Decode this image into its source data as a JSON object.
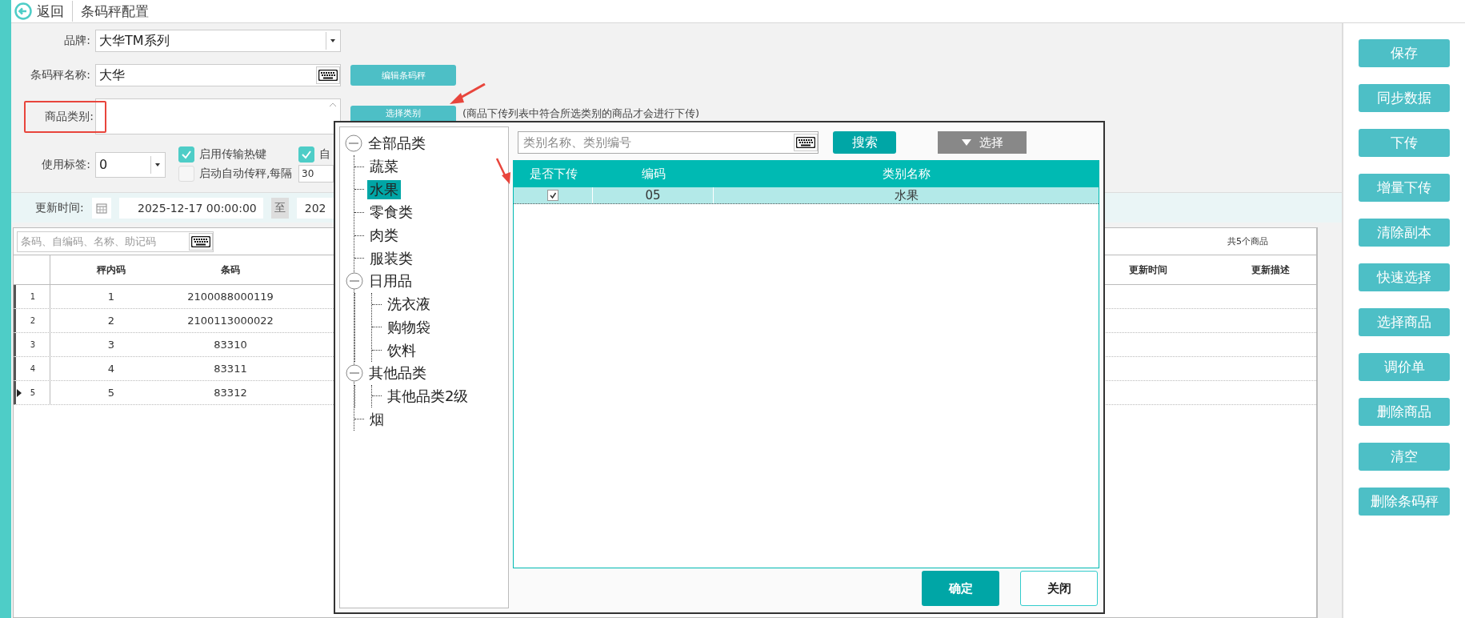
{
  "header": {
    "back": "返回",
    "title": "条码秤配置"
  },
  "form": {
    "brand": {
      "label": "品牌:",
      "value": "大华TM系列"
    },
    "scale_name": {
      "label": "条码秤名称:",
      "value": "大华"
    },
    "edit_button": "编辑条码秤",
    "category": {
      "label": "商品类别:",
      "highlighted": true
    },
    "select_category_button": "选择类别",
    "hint": "(商品下传列表中符合所选类别的商品才会进行下传)",
    "tag": {
      "label": "使用标签:",
      "value": "0"
    },
    "options": [
      {
        "label": "启用传输热键",
        "checked": true
      },
      {
        "label": "启动自动传秤,每隔",
        "checked": false
      },
      {
        "label": "自",
        "checked": true
      }
    ],
    "interval": "30"
  },
  "filter": {
    "label": "更新时间:",
    "from": "2025-12-17 00:00:00",
    "separator": "至",
    "to": "202"
  },
  "grid": {
    "search_placeholder": "条码、自编码、名称、助记码",
    "count": "共5个商品",
    "columns": [
      "秤内码",
      "条码",
      "更新时间",
      "更新描述"
    ],
    "rows": [
      {
        "number": "1",
        "code": "1",
        "barcode": "2100088000119",
        "current": false
      },
      {
        "number": "2",
        "code": "2",
        "barcode": "2100113000022",
        "current": false
      },
      {
        "number": "3",
        "code": "3",
        "barcode": "83310",
        "current": false
      },
      {
        "number": "4",
        "code": "4",
        "barcode": "83311",
        "current": false
      },
      {
        "number": "5",
        "code": "5",
        "barcode": "83312",
        "current": true
      }
    ]
  },
  "actions": [
    "保存",
    "同步数据",
    "下传",
    "增量下传",
    "清除副本",
    "快速选择",
    "选择商品",
    "调价单",
    "删除商品",
    "清空",
    "删除条码秤"
  ],
  "dialog": {
    "tree": [
      {
        "label": "全部品类",
        "selected": false,
        "expanded": true,
        "children": [
          {
            "label": "蔬菜",
            "selected": false
          },
          {
            "label": "水果",
            "selected": true
          },
          {
            "label": "零食类",
            "selected": false
          },
          {
            "label": "肉类",
            "selected": false
          },
          {
            "label": "服装类",
            "selected": false
          },
          {
            "label": "日用品",
            "selected": false,
            "expanded": true,
            "children": [
              {
                "label": "洗衣液",
                "selected": false
              },
              {
                "label": "购物袋",
                "selected": false
              },
              {
                "label": "饮料",
                "selected": false
              }
            ]
          },
          {
            "label": "其他品类",
            "selected": false,
            "expanded": true,
            "children": [
              {
                "label": "其他品类2级",
                "selected": false
              }
            ]
          },
          {
            "label": "烟",
            "selected": false
          }
        ]
      }
    ],
    "search_placeholder": "类别名称、类别编号",
    "search_button": "搜索",
    "select_button": "选择",
    "columns": [
      "是否下传",
      "编码",
      "类别名称"
    ],
    "rows": [
      {
        "upload": true,
        "code": "05",
        "name": "水果",
        "selected": true
      }
    ],
    "confirm": "确定",
    "close": "关闭"
  }
}
